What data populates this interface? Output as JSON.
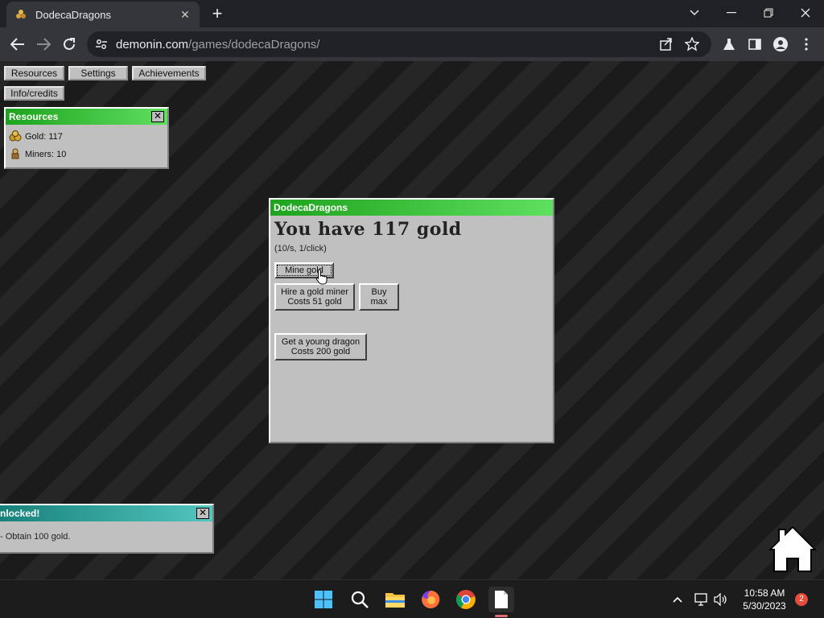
{
  "browser": {
    "tab_title": "DodecaDragons",
    "tab_close": "✕",
    "new_tab": "+",
    "url_host": "demonin.com",
    "url_path": "/games/dodecaDragons/"
  },
  "menu": {
    "resources": "Resources",
    "settings": "Settings",
    "achievements": "Achievements",
    "info_credits": "Info/credits"
  },
  "resources_window": {
    "title": "Resources",
    "close": "✕",
    "gold": "Gold: 117",
    "miners": "Miners: 10"
  },
  "main_window": {
    "title": "DodecaDragons",
    "heading": "You have 117 gold",
    "rate": "(10/s, 1/click)",
    "mine_button": "Mine gold",
    "hire_line1": "Hire a gold miner",
    "hire_line2": "Costs 51 gold",
    "buy_max_line1": "Buy",
    "buy_max_line2": "max",
    "dragon_line1": "Get a young dragon",
    "dragon_line2": "Costs 200 gold"
  },
  "achievement_popup": {
    "title": "nlocked!",
    "close": "✕",
    "text": "- Obtain 100 gold."
  },
  "taskbar": {
    "time": "10:58 AM",
    "date": "5/30/2023",
    "notifications": "2"
  },
  "colors": {
    "window_title_green": "#1ea31e",
    "popup_title_teal": "#17807a",
    "window_body": "#c0c0c0"
  }
}
